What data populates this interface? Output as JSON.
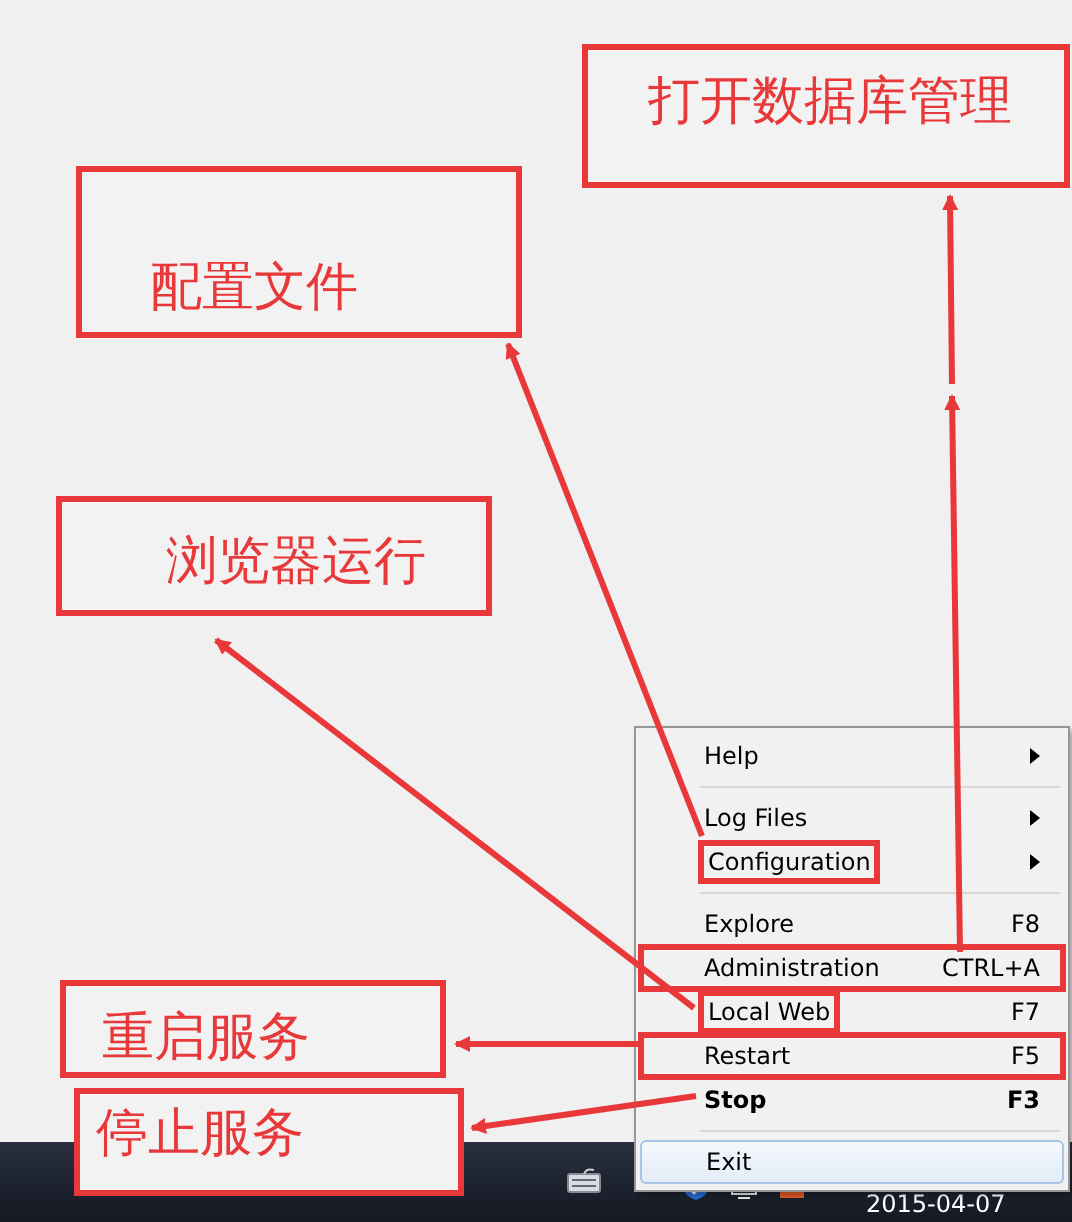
{
  "annotations": [
    {
      "text": "打开数据库管理"
    },
    {
      "text": "配置文件"
    },
    {
      "text": "浏览器运行"
    },
    {
      "text": "重启服务"
    },
    {
      "text": "停止服务"
    }
  ],
  "menu": {
    "items": [
      {
        "kind": "item",
        "label": "Help",
        "submenu": true
      },
      {
        "kind": "separator"
      },
      {
        "kind": "item",
        "label": "Log Files",
        "submenu": true
      },
      {
        "kind": "item",
        "label": "Configuration",
        "submenu": true,
        "boxed_label": true
      },
      {
        "kind": "separator"
      },
      {
        "kind": "item",
        "label": "Explore",
        "shortcut": "F8"
      },
      {
        "kind": "item",
        "label": "Administration",
        "shortcut": "CTRL+A",
        "boxed_row": true
      },
      {
        "kind": "item",
        "label": "Local Web",
        "shortcut": "F7",
        "boxed_label": true
      },
      {
        "kind": "item",
        "label": "Restart",
        "shortcut": "F5",
        "boxed_row": true
      },
      {
        "kind": "item",
        "label": "Stop",
        "shortcut": "F3",
        "bold": true
      },
      {
        "kind": "separator"
      },
      {
        "kind": "item",
        "label": "Exit",
        "highlighted": true
      }
    ]
  },
  "taskbar": {
    "date": "2015-04-07"
  }
}
